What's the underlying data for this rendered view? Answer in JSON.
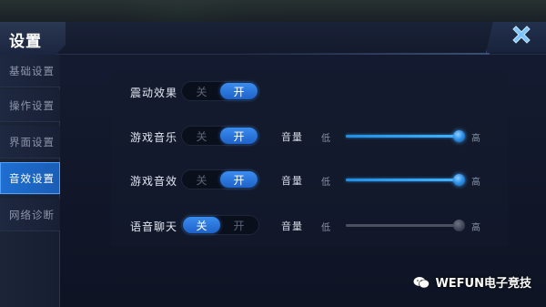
{
  "header": {
    "title": "设置"
  },
  "sidebar": {
    "items": [
      {
        "label": "基础设置",
        "active": false
      },
      {
        "label": "操作设置",
        "active": false
      },
      {
        "label": "界面设置",
        "active": false
      },
      {
        "label": "音效设置",
        "active": true
      },
      {
        "label": "网络诊断",
        "active": false
      }
    ]
  },
  "settings": {
    "vibration": {
      "label": "震动效果",
      "off_label": "关",
      "on_label": "开",
      "state": "on"
    },
    "music": {
      "label": "游戏音乐",
      "off_label": "关",
      "on_label": "开",
      "state": "on",
      "volume_label": "音量",
      "low_label": "低",
      "high_label": "高",
      "volume_level": 1.0
    },
    "sfx": {
      "label": "游戏音效",
      "off_label": "关",
      "on_label": "开",
      "state": "on",
      "volume_label": "音量",
      "low_label": "低",
      "high_label": "高",
      "volume_level": 1.0
    },
    "voice": {
      "label": "语音聊天",
      "off_label": "关",
      "on_label": "开",
      "state": "off",
      "volume_label": "音量",
      "low_label": "低",
      "high_label": "高",
      "volume_level": 1.0
    }
  },
  "watermark": {
    "text": "WEFUN电子竞技"
  },
  "colors": {
    "accent": "#2a7fe6",
    "panel": "#141b30"
  },
  "icons": {
    "close": "close-icon",
    "watermark": "wechat-icon"
  }
}
